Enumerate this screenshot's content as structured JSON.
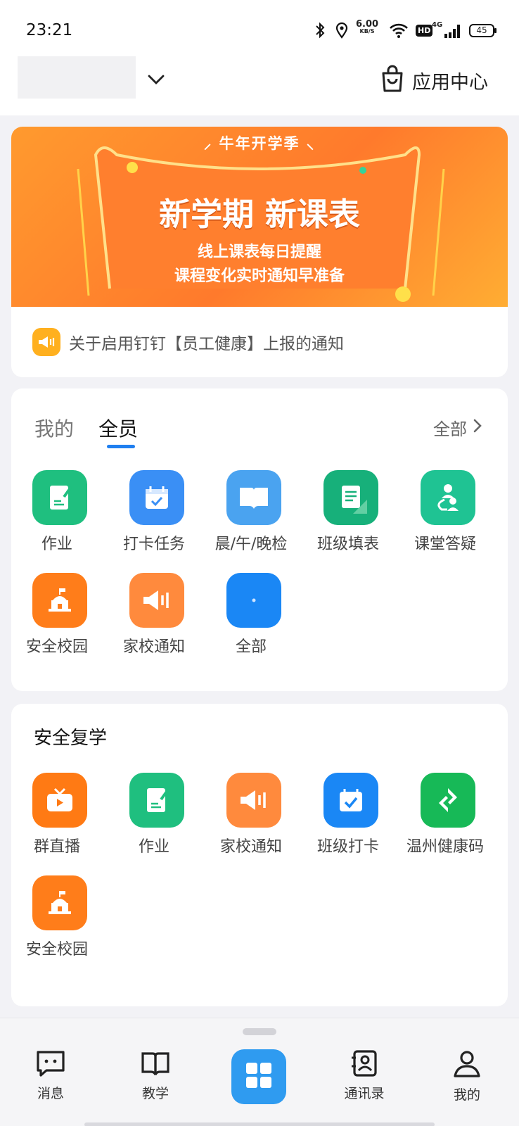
{
  "status_bar": {
    "time": "23:21",
    "net_speed_value": "6.00",
    "net_speed_unit": "KB/S",
    "hd": "HD",
    "signal": "4G",
    "battery": "45"
  },
  "header": {
    "app_center_label": "应用中心"
  },
  "banner": {
    "season": "⸝ 牛年开学季 ⸜",
    "title": "新学期 新课表",
    "subtitle_line1": "线上课表每日提醒",
    "subtitle_line2": "课程变化实时通知早准备"
  },
  "notice": {
    "text": "关于启用钉钉【员工健康】上报的通知"
  },
  "apps_card": {
    "tabs": [
      {
        "label": "我的",
        "active": false
      },
      {
        "label": "全员",
        "active": true
      }
    ],
    "all_label": "全部",
    "items": [
      {
        "label": "作业",
        "icon": "homework-icon",
        "color": "#1fbf7f"
      },
      {
        "label": "打卡任务",
        "icon": "checkin-task-icon",
        "color": "#3a8ff5"
      },
      {
        "label": "晨/午/晚检",
        "icon": "book-icon",
        "color": "#4aa3f0"
      },
      {
        "label": "班级填表",
        "icon": "class-form-icon",
        "color": "#17b07a"
      },
      {
        "label": "课堂答疑",
        "icon": "qa-icon",
        "color": "#1fc393"
      },
      {
        "label": "安全校园",
        "icon": "campus-icon",
        "color": "#ff7d1a"
      },
      {
        "label": "家校通知",
        "icon": "megaphone-icon",
        "color": "#ff8a3d"
      },
      {
        "label": "全部",
        "icon": "all-apps-icon",
        "color": "#1a87f5"
      }
    ]
  },
  "safety_card": {
    "title": "安全复学",
    "items": [
      {
        "label": "群直播",
        "icon": "live-tv-icon",
        "color": "#ff7a14"
      },
      {
        "label": "作业",
        "icon": "homework-icon",
        "color": "#1fbf7f"
      },
      {
        "label": "家校通知",
        "icon": "megaphone-icon",
        "color": "#ff8a3d"
      },
      {
        "label": "班级打卡",
        "icon": "class-checkin-icon",
        "color": "#1a87f5"
      },
      {
        "label": "温州健康码",
        "icon": "health-code-icon",
        "color": "#17b957"
      },
      {
        "label": "安全校园",
        "icon": "campus-icon",
        "color": "#ff7d1a"
      }
    ]
  },
  "bottom_nav": {
    "items": [
      {
        "label": "消息",
        "icon": "message-icon"
      },
      {
        "label": "教学",
        "icon": "teaching-icon"
      },
      {
        "label": "",
        "icon": "workbench-icon"
      },
      {
        "label": "通讯录",
        "icon": "contacts-icon"
      },
      {
        "label": "我的",
        "icon": "profile-icon"
      }
    ]
  }
}
